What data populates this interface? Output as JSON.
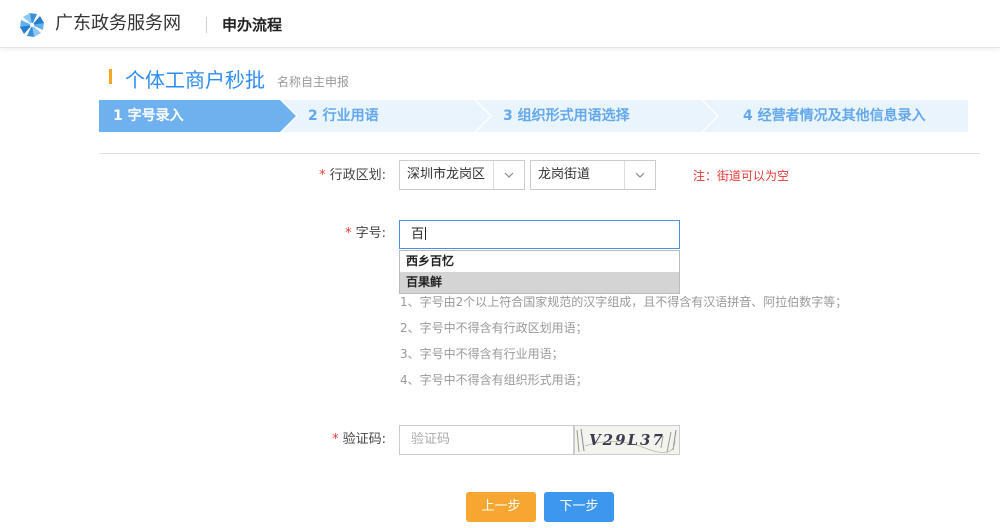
{
  "header": {
    "site_name": "广东政务服务网",
    "section": "申办流程"
  },
  "page": {
    "title": "个体工商户秒批",
    "subtitle": "名称自主申报"
  },
  "steps": [
    {
      "label": "1 字号录入",
      "active": true
    },
    {
      "label": "2 行业用语",
      "active": false
    },
    {
      "label": "3 组织形式用语选择",
      "active": false
    },
    {
      "label": "4 经营者情况及其他信息录入",
      "active": false
    }
  ],
  "form": {
    "required_mark": "*",
    "region": {
      "label": "行政区划:",
      "district": "深圳市龙岗区",
      "street": "龙岗街道",
      "note": "注：街道可以为空"
    },
    "name": {
      "label": "字号:",
      "value": "百",
      "suggestions": [
        "西乡百忆",
        "百果鲜"
      ]
    },
    "rules": [
      "1、字号由2个以上符合国家规范的汉字组成，且不得含有汉语拼音、阿拉伯数字等；",
      "2、字号中不得含有行政区划用语；",
      "3、字号中不得含有行业用语；",
      "4、字号中不得含有组织形式用语；"
    ],
    "captcha": {
      "label": "验证码:",
      "placeholder": "验证码",
      "image_text": "V29L37"
    }
  },
  "buttons": {
    "prev": "上一步",
    "next": "下一步"
  },
  "colors": {
    "accent_blue": "#2d8cf0",
    "step_active": "#6fb1ee",
    "step_inactive": "#eaf4fd",
    "prev_button": "#f7a631",
    "next_button": "#3d97ee",
    "required_red": "#e53935",
    "title_bar": "#f5a623"
  }
}
